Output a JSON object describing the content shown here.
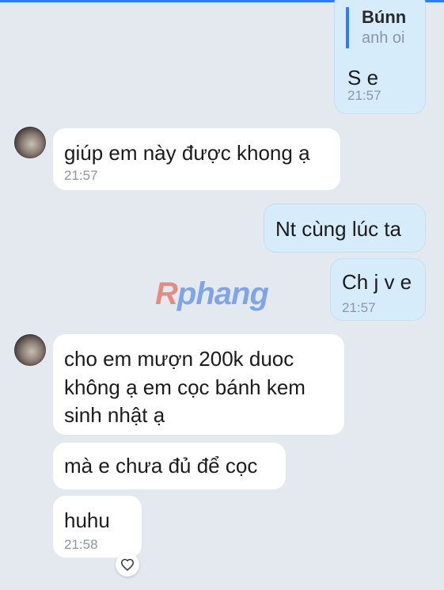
{
  "reply_quote": {
    "name": "Bún‍n",
    "text": "anh oi"
  },
  "messages": [
    {
      "side": "out",
      "text": "S e",
      "time": "21:57"
    },
    {
      "side": "in",
      "text": "giúp em này được khong ạ",
      "time": "21:57"
    },
    {
      "side": "out",
      "text": "Nt cùng lúc ta",
      "time": ""
    },
    {
      "side": "out",
      "text": "Ch j v e",
      "time": "21:57"
    },
    {
      "side": "in",
      "lines": [
        "cho em mượn 200k duoc",
        "không ạ em cọc bánh kem",
        "sinh nhật ạ"
      ],
      "time": ""
    },
    {
      "side": "in",
      "text": "mà e chưa đủ để cọc",
      "time": ""
    },
    {
      "side": "in",
      "text": "huhu",
      "time": "21:58"
    }
  ],
  "watermark": {
    "first": "R",
    "rest": "phang"
  },
  "icons": {
    "reaction": "heart-outline-icon",
    "avatar": "contact-avatar"
  },
  "colors": {
    "accent": "#2f7cf6",
    "outgoing_bubble": "#d7ecfb",
    "incoming_bubble": "#ffffff",
    "background": "#e4e9f0"
  }
}
